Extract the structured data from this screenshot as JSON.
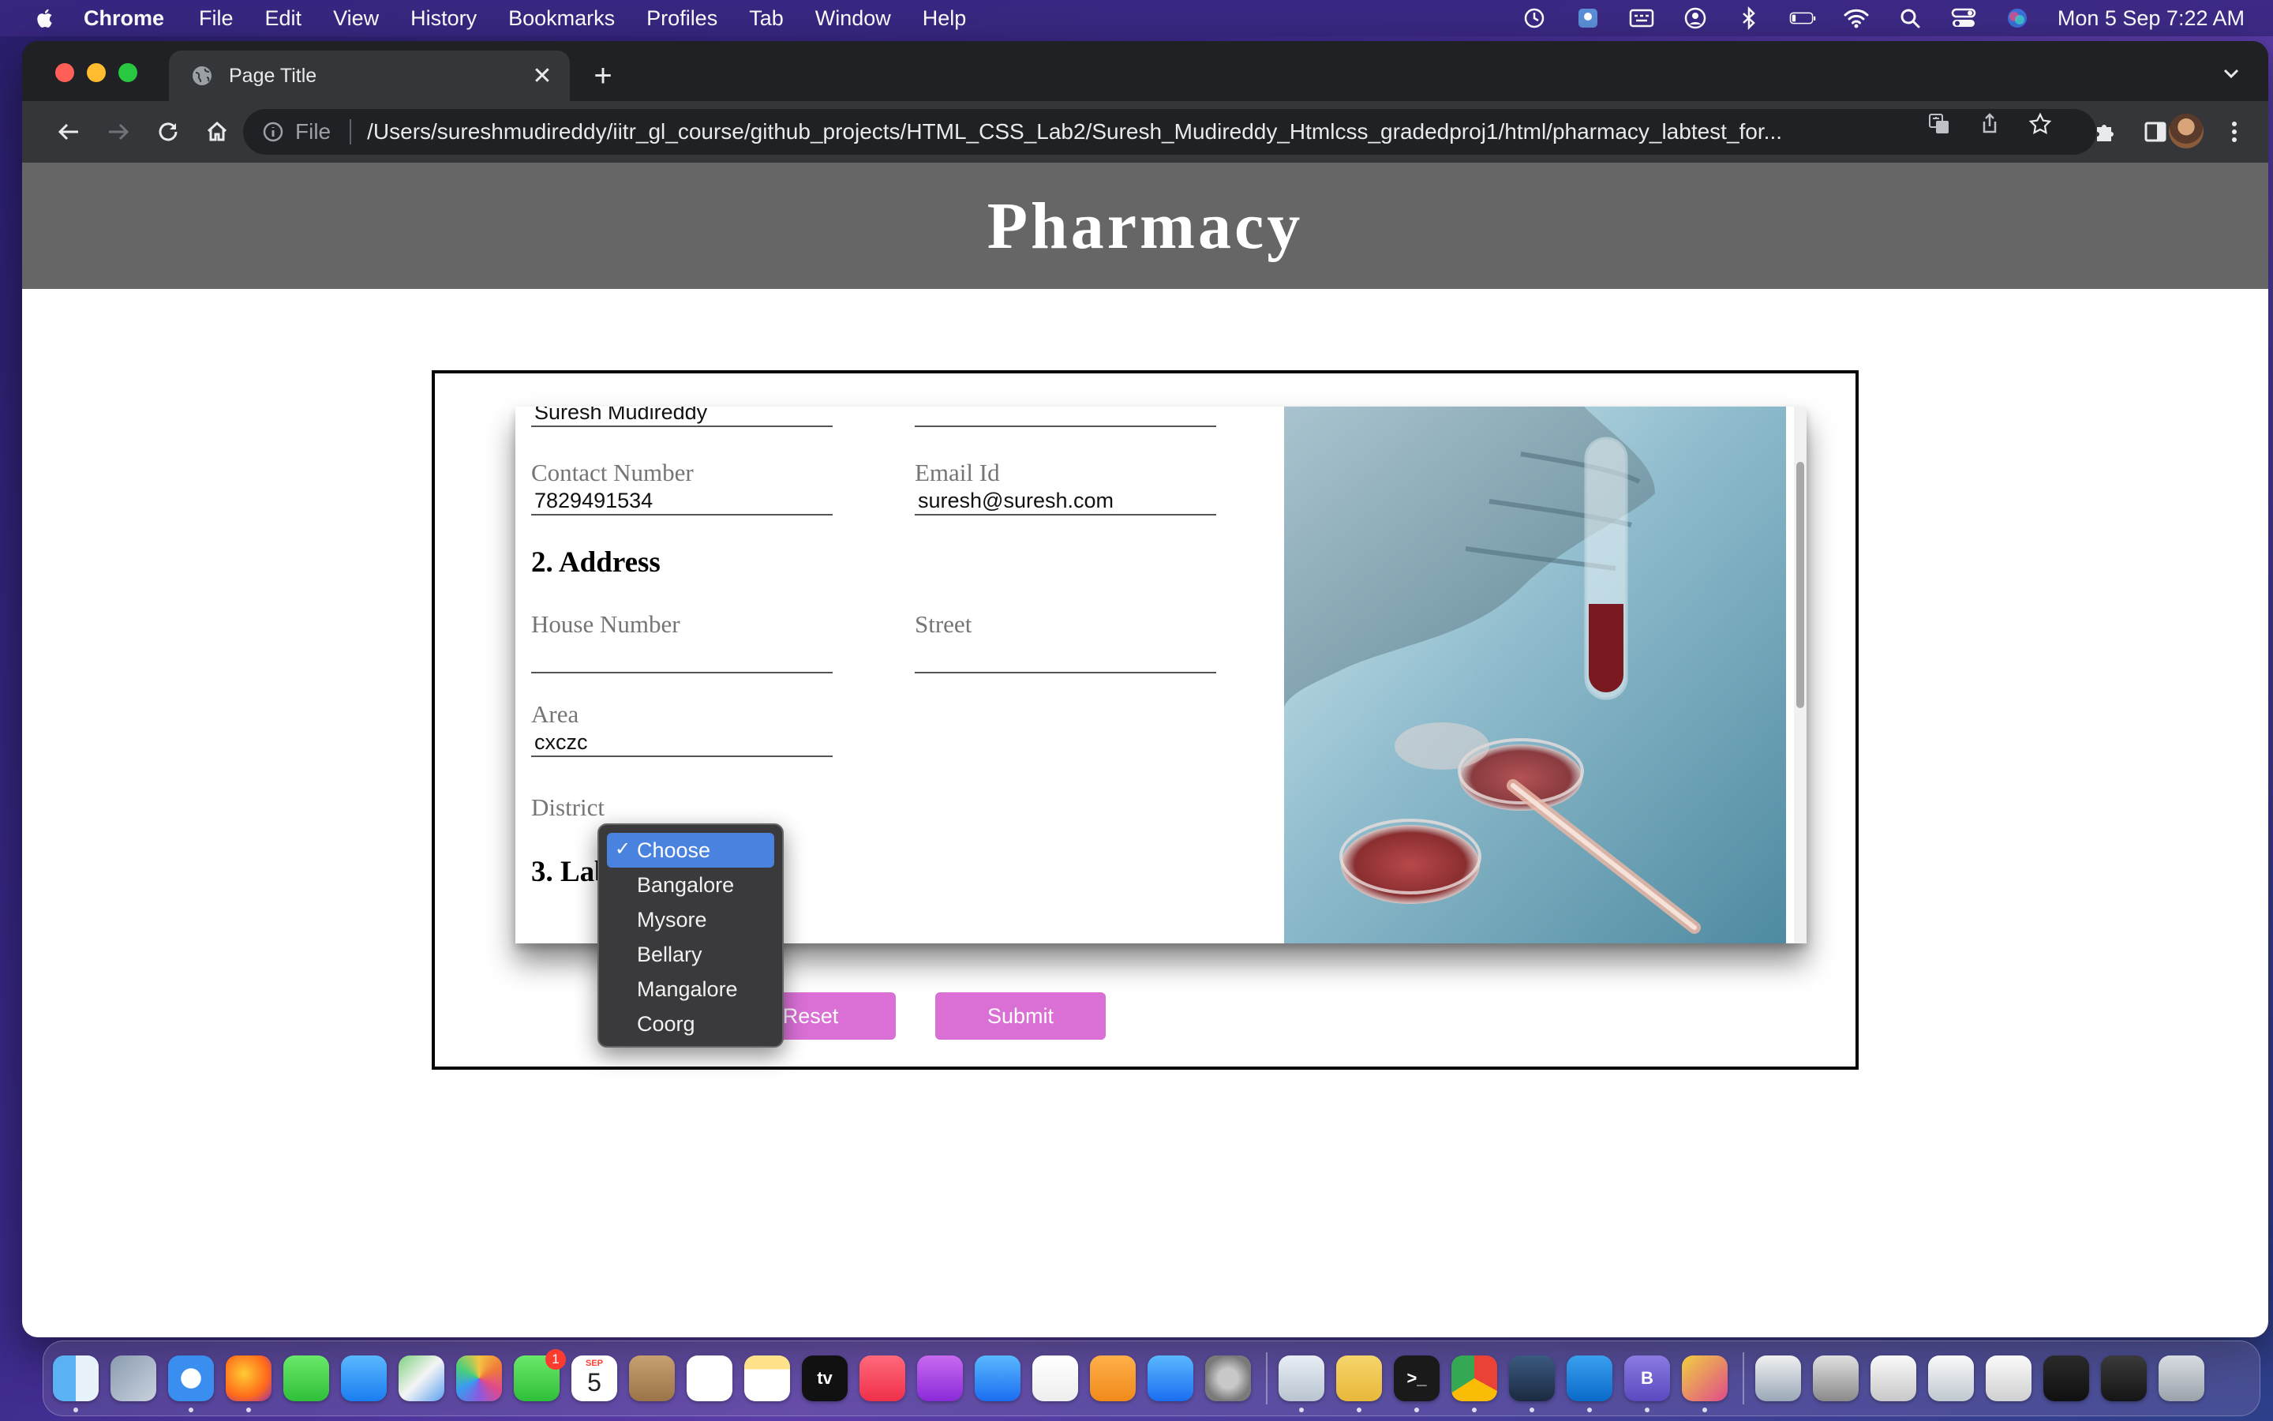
{
  "menubar": {
    "app_name": "Chrome",
    "items": [
      "File",
      "Edit",
      "View",
      "History",
      "Bookmarks",
      "Profiles",
      "Tab",
      "Window",
      "Help"
    ],
    "clock": "Mon 5 Sep  7:22 AM"
  },
  "browser": {
    "tab_title": "Page Title",
    "scheme_label": "File",
    "url": "/Users/sureshmudireddy/iitr_gl_course/github_projects/HTML_CSS_Lab2/Suresh_Mudireddy_Htmlcss_gradedproj1/html/pharmacy_labtest_for..."
  },
  "page": {
    "header_title": "Pharmacy",
    "form": {
      "name_value": "Suresh Mudireddy",
      "top_right_value": "",
      "contact_label": "Contact Number",
      "contact_value": "7829491534",
      "email_label": "Email Id",
      "email_value": "suresh@suresh.com",
      "address_heading": "2. Address",
      "house_label": "House Number",
      "house_value": "",
      "street_label": "Street",
      "street_value": "",
      "area_label": "Area",
      "area_value": "cxczc",
      "district_label": "District",
      "lab_heading": "3. Lab"
    },
    "buttons": {
      "reset": "Reset",
      "submit": "Submit"
    },
    "dropdown": {
      "selected": "Choose",
      "options": [
        "Choose",
        "Bangalore",
        "Mysore",
        "Bellary",
        "Mangalore",
        "Coorg"
      ]
    }
  },
  "dock": {
    "calendar_month": "SEP",
    "calendar_day": "5",
    "facetime_badge": "1",
    "tv_label": "tv",
    "terminal_label": ">_",
    "bbedit_label": "B",
    "colors": {
      "accent": "#da70d6",
      "header": "#666666",
      "selection": "#4a82e0"
    }
  }
}
